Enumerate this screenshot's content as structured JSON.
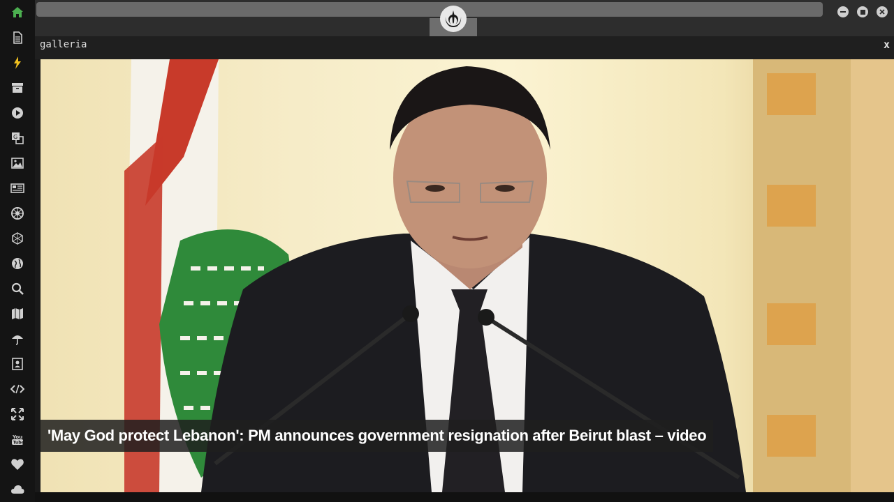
{
  "window": {
    "title": "galleria",
    "close_label": "x"
  },
  "sidebar": {
    "items": [
      {
        "icon": "home-icon",
        "color": "#4caf50"
      },
      {
        "icon": "document-icon",
        "color": "#d0d0d0"
      },
      {
        "icon": "lightning-icon",
        "color": "#f0c020"
      },
      {
        "icon": "archive-icon",
        "color": "#d0d0d0"
      },
      {
        "icon": "play-icon",
        "color": "#d0d0d0"
      },
      {
        "icon": "translate-icon",
        "color": "#d0d0d0"
      },
      {
        "icon": "image-icon",
        "color": "#d0d0d0"
      },
      {
        "icon": "newspaper-icon",
        "color": "#d0d0d0"
      },
      {
        "icon": "empire-icon",
        "color": "#d0d0d0"
      },
      {
        "icon": "hexagon-icon",
        "color": "#d0d0d0"
      },
      {
        "icon": "globe-icon",
        "color": "#d0d0d0"
      },
      {
        "icon": "search-icon",
        "color": "#d0d0d0"
      },
      {
        "icon": "map-icon",
        "color": "#d0d0d0"
      },
      {
        "icon": "umbrella-icon",
        "color": "#d0d0d0"
      },
      {
        "icon": "contact-card-icon",
        "color": "#d0d0d0"
      },
      {
        "icon": "code-icon",
        "color": "#d0d0d0"
      },
      {
        "icon": "expand-icon",
        "color": "#d0d0d0"
      },
      {
        "icon": "youtube-icon",
        "color": "#d0d0d0"
      },
      {
        "icon": "heart-icon",
        "color": "#d0d0d0"
      },
      {
        "icon": "cloud-icon",
        "color": "#d0d0d0"
      }
    ]
  },
  "gallery": {
    "caption": "'May God protect Lebanon': PM announces government resignation after Beirut blast – video"
  },
  "colors": {
    "sidebar_bg": "#141414",
    "topbar_bg": "#2d2d2d",
    "accent_green": "#4caf50"
  }
}
